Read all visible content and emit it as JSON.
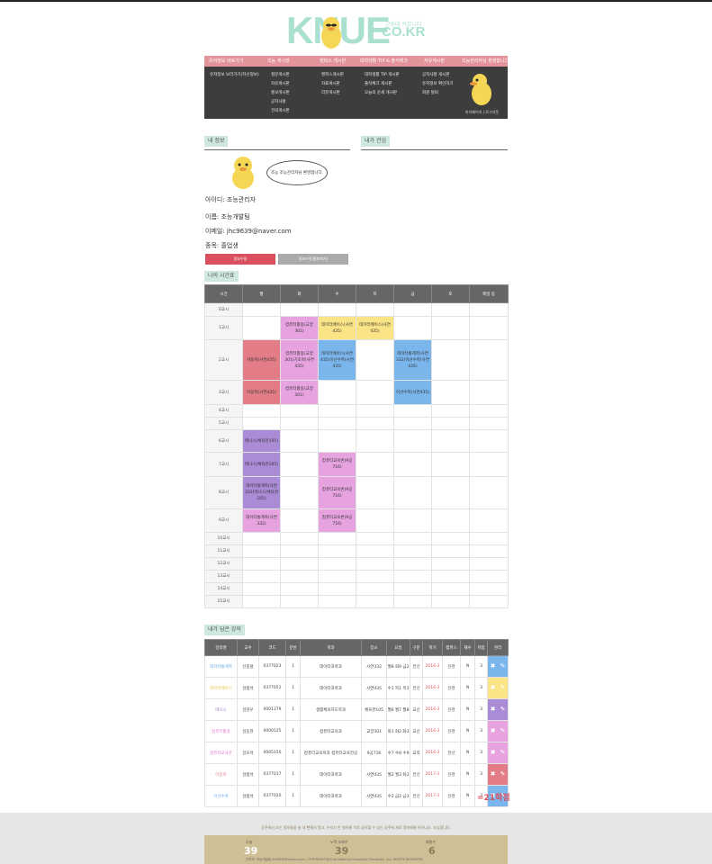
{
  "site": {
    "logo_big": "KNUE",
    "logo_small": "CO.KR",
    "logo_tag": "교원대 커뮤니티"
  },
  "nav": {
    "headers": [
      "유저정보 바로가기",
      "조능 게시판",
      "멘파스 게시판",
      "대학생활 TIP & 출석체크",
      "자유게시판",
      "조능관리자님 환영합니다."
    ],
    "col1": [
      "유저정보 보러가기(자신정보)"
    ],
    "col2": [
      "질문게시판",
      "자유게시판",
      "홍보게시판",
      "공지사항",
      "건의게시판"
    ],
    "col3": [
      "멘파스게시판",
      "자료게시판",
      "리뷰게시판"
    ],
    "col4": [
      "대학생활 TIP 게시판",
      "출석체크 게시판",
      "오늘의 운세 게시판"
    ],
    "col5": [
      "공지사항 게시판",
      "유저정보 확인하기",
      "회원 탈퇴"
    ],
    "footer": "마이페이지  |  로그아웃"
  },
  "profile": {
    "title": "내 정보",
    "interest_title": "내가 관심",
    "bubble": "조능 조능관리자님 환영합니다.",
    "id_line": "아이디: 조능관리자",
    "name_line": "이름: 조능개발팀",
    "email_line": "이메일: jhc9639@naver.com",
    "dept_line": "종목: 졸업생",
    "btn_edit": "정보수정",
    "btn_withdraw": "정보수정(탈퇴하기)"
  },
  "timetable": {
    "title": "나의 시간표",
    "headers": [
      "시간",
      "월",
      "화",
      "수",
      "목",
      "금",
      "토",
      "메일 등"
    ],
    "times": [
      "0교시",
      "1교시",
      "2교시",
      "3교시",
      "4교시",
      "5교시",
      "6교시",
      "7교시",
      "8교시",
      "9교시",
      "10교시",
      "11교시",
      "12교시",
      "13교시",
      "14교시",
      "15교시"
    ]
  },
  "cells": {
    "tue1": "컴퓨터활용(교양301)",
    "wed1": "데이터베이스(사연435)",
    "thu1": "데이터베이스(사연435)",
    "mon2": "이동학(사연435)",
    "tue2": "컴퓨터활용(교양301)기초학(사연435)",
    "wed2": "데이터베이스(사연435)이산수학(사연435)",
    "fri2": "데이터통계학(사연332)이산수학(사연435)",
    "mon3": "이동학(사연435)",
    "tue3": "컴퓨터활용(교양301)",
    "fri3": "이산수학(사연435)",
    "mon6": "테니스(체육관105)",
    "mon7": "테니스(체육관105)",
    "wed7": "컴퓨터교육론(9공716)",
    "mon8": "데이터통계학(사연332)테니스(체육관105)",
    "wed8": "컴퓨터교육론(9공716)",
    "mon9": "데이터통계학(사연332)",
    "wed9": "컴퓨터교육론(9공716)"
  },
  "lectures": {
    "title": "내가 담은 강의",
    "headers": [
      "강의명",
      "교수",
      "코드",
      "분반",
      "학과",
      "장소",
      "요일",
      "구분",
      "학기",
      "캠퍼스",
      "재수",
      "학점",
      "관리"
    ],
    "rows": [
      [
        "데이터통계학",
        "신종렬",
        "0377023",
        "1",
        "데이터과학과",
        "사연332",
        "월8 화9 금2",
        "전선",
        "2016-2",
        "신관",
        "N",
        "3"
      ],
      [
        "데이터베이스",
        "김범석",
        "0377051",
        "1",
        "데이터과학과",
        "사연435",
        "수1 목1 목1",
        "전선",
        "2016-2",
        "신관",
        "N",
        "3"
      ],
      [
        "테니스",
        "김현우",
        "0001379",
        "1",
        "생활체육지도학과",
        "체육관105",
        "월6 월7 월8",
        "교선",
        "2016-2",
        "신관",
        "N",
        "3"
      ],
      [
        "컴퓨터활용",
        "김동현",
        "0000125",
        "1",
        "컴퓨터교육과",
        "교양301",
        "화1 화2 화3",
        "교선",
        "2016-2",
        "신관",
        "N",
        "3"
      ],
      [
        "컴퓨터교육론",
        "강오석",
        "0005150",
        "1",
        "컴퓨터교육학과 컴퓨터교육전공",
        "9공716",
        "수7 수8 수9",
        "교직",
        "2016-2",
        "전선",
        "N",
        "3"
      ],
      [
        "이동학",
        "김범석",
        "0377017",
        "1",
        "데이터과학과",
        "사연435",
        "월2 월3 화2",
        "전선",
        "2017-1",
        "신관",
        "N",
        "3"
      ],
      [
        "이산수학",
        "김범석",
        "0377020",
        "1",
        "데이터과학과",
        "사연435",
        "수2 금2 금3",
        "전선",
        "2017-1",
        "신관",
        "N",
        "3"
      ]
    ],
    "credits": "=21학점"
  },
  "footer": {
    "msg": "공주에서 조는 정보들을 늘 새 뻔해서 알고, 우리가 돈 벌어줄 이로 공유할 수 있는 공주에 새로 정보해줄 이유니다. 조능합니다.",
    "today_label": "오늘",
    "today": "39",
    "total_label": "누적 조회수",
    "total": "39",
    "members_label": "회원수",
    "members": "6",
    "copy": "관리자: 조능개발팀  jhc9639@naver.com  |  COPYRIGHT@Knue National University Education. ALL RIGHTS RESERVED"
  },
  "colors": {
    "pink": "#e6a3e0",
    "yellow": "#fbe485",
    "blue": "#7ab5eb",
    "red": "#e27c86",
    "purple": "#a98bd6",
    "header": "#666666",
    "navbar": "#e2949a"
  }
}
